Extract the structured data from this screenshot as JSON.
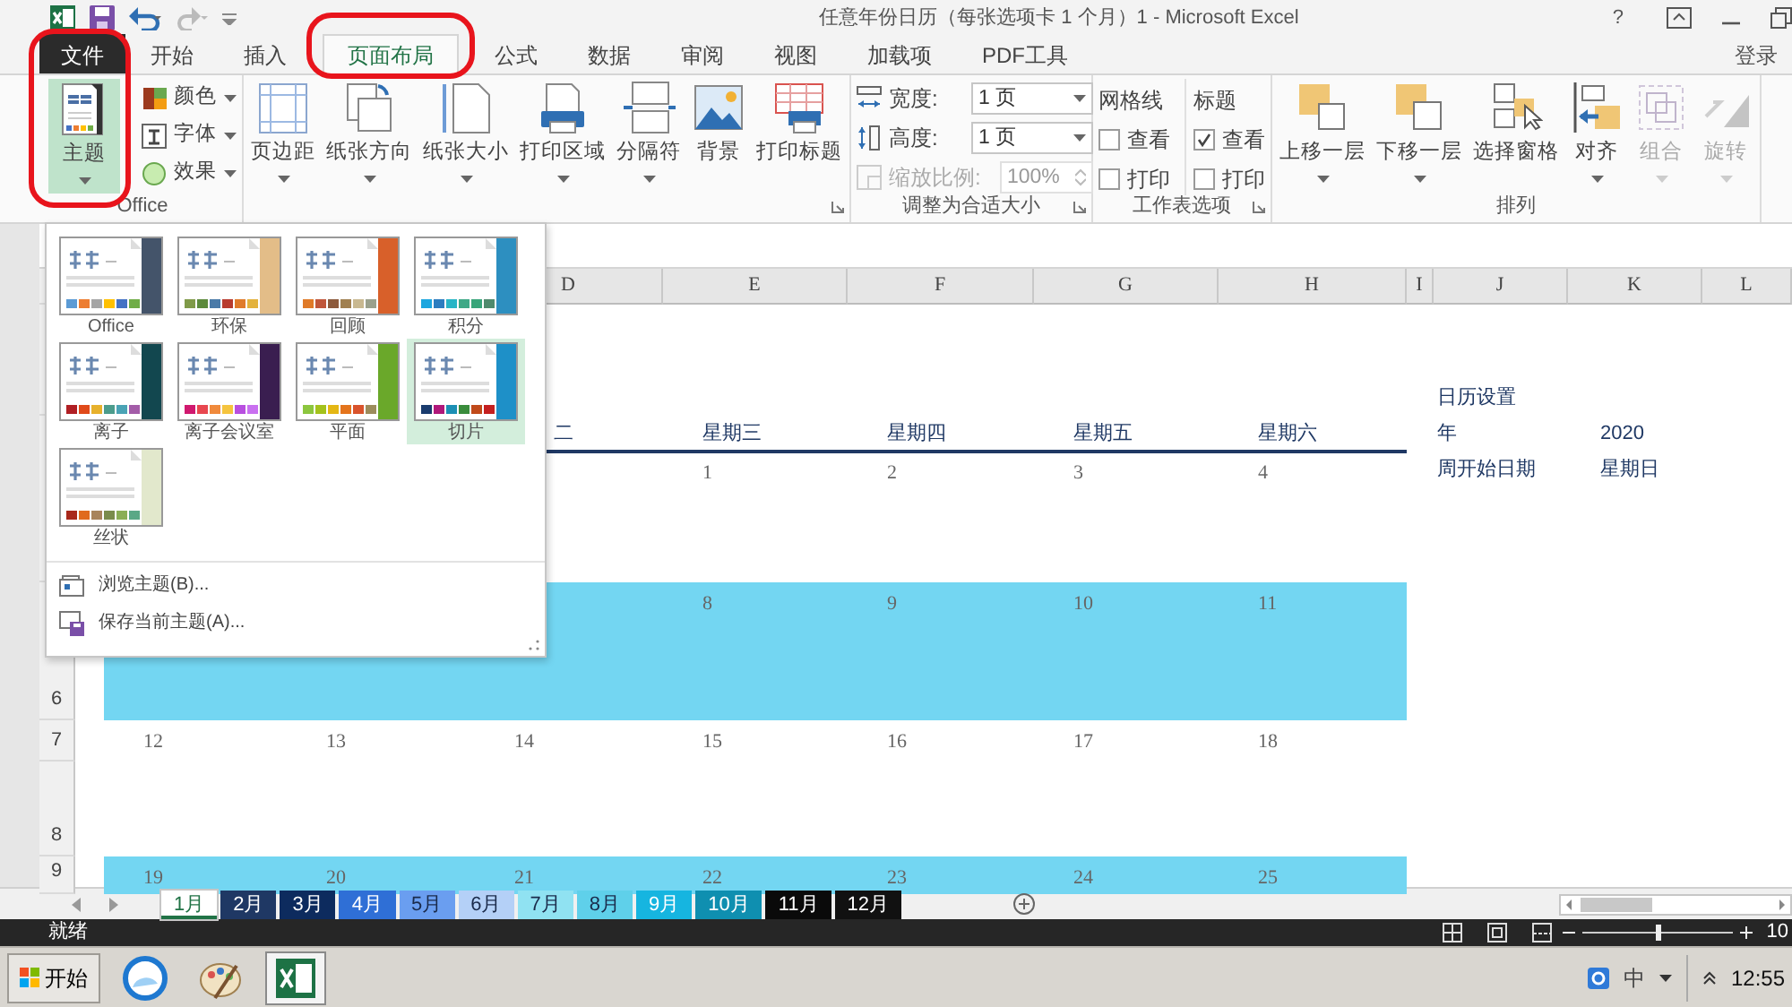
{
  "window": {
    "title": "任意年份日历（每张选项卡 1 个月）1 - Microsoft Excel",
    "help": "?"
  },
  "tabs": [
    {
      "label": "文件",
      "kind": "file",
      "selected": false,
      "highlighted": false
    },
    {
      "label": "开始",
      "kind": "tab",
      "selected": false,
      "highlighted": false
    },
    {
      "label": "插入",
      "kind": "tab",
      "selected": false,
      "highlighted": false
    },
    {
      "label": "页面布局",
      "kind": "tab",
      "selected": true,
      "highlighted": true
    },
    {
      "label": "公式",
      "kind": "tab",
      "selected": false,
      "highlighted": false
    },
    {
      "label": "数据",
      "kind": "tab",
      "selected": false,
      "highlighted": false
    },
    {
      "label": "审阅",
      "kind": "tab",
      "selected": false,
      "highlighted": false
    },
    {
      "label": "视图",
      "kind": "tab",
      "selected": false,
      "highlighted": false
    },
    {
      "label": "加载项",
      "kind": "tab",
      "selected": false,
      "highlighted": false
    },
    {
      "label": "PDF工具",
      "kind": "tab",
      "selected": false,
      "highlighted": false
    }
  ],
  "account": "登录",
  "ribbon": {
    "groups": [
      {
        "kind": "buttons",
        "label": "Office",
        "launcher": false,
        "buttons": [
          {
            "label": "主题",
            "kind": "large",
            "dropdown": true,
            "selected": true,
            "highlighted": true,
            "disabled": false
          },
          {
            "label": "颜色",
            "kind": "small",
            "dropdown": true,
            "selected": false,
            "highlighted": false,
            "disabled": false
          },
          {
            "label": "字体",
            "kind": "small",
            "dropdown": true,
            "selected": false,
            "highlighted": false,
            "disabled": false
          },
          {
            "label": "效果",
            "kind": "small",
            "dropdown": true,
            "selected": false,
            "highlighted": false,
            "disabled": false
          }
        ]
      },
      {
        "kind": "buttons",
        "launcher": true,
        "buttons": [
          {
            "label": "页边距",
            "kind": "large",
            "dropdown": true,
            "selected": false,
            "highlighted": false,
            "disabled": false
          },
          {
            "label": "纸张方向",
            "kind": "large",
            "dropdown": true,
            "selected": false,
            "highlighted": false,
            "disabled": false
          },
          {
            "label": "纸张大小",
            "kind": "large",
            "dropdown": true,
            "selected": false,
            "highlighted": false,
            "disabled": false
          },
          {
            "label": "打印区域",
            "kind": "large",
            "dropdown": true,
            "selected": false,
            "highlighted": false,
            "disabled": false
          },
          {
            "label": "分隔符",
            "kind": "large",
            "dropdown": true,
            "selected": false,
            "highlighted": false,
            "disabled": false
          },
          {
            "label": "背景",
            "kind": "large",
            "dropdown": false,
            "selected": false,
            "highlighted": false,
            "disabled": false
          },
          {
            "label": "打印标题",
            "kind": "large",
            "dropdown": false,
            "selected": false,
            "highlighted": false,
            "disabled": false
          }
        ]
      },
      {
        "kind": "scale",
        "label": "调整为合适大小",
        "launcher": true,
        "fields": [
          {
            "label": "宽度:",
            "value": "1 页",
            "disabled": false
          },
          {
            "label": "高度:",
            "value": "1 页",
            "disabled": false
          },
          {
            "label": "缩放比例:",
            "value": "100%",
            "disabled": true
          }
        ]
      },
      {
        "kind": "options",
        "label": "工作表选项",
        "launcher": true,
        "columns": [
          {
            "title": "网格线",
            "checks": [
              {
                "label": "查看",
                "checked": false
              },
              {
                "label": "打印",
                "checked": false
              }
            ]
          },
          {
            "title": "标题",
            "checks": [
              {
                "label": "查看",
                "checked": true
              },
              {
                "label": "打印",
                "checked": false
              }
            ]
          }
        ]
      },
      {
        "kind": "buttons",
        "label": "排列",
        "launcher": false,
        "buttons": [
          {
            "label": "上移一层",
            "kind": "large",
            "dropdown": true,
            "selected": false,
            "highlighted": false,
            "disabled": false
          },
          {
            "label": "下移一层",
            "kind": "large",
            "dropdown": true,
            "selected": false,
            "highlighted": false,
            "disabled": false
          },
          {
            "label": "选择窗格",
            "kind": "large",
            "dropdown": false,
            "selected": false,
            "highlighted": false,
            "disabled": false
          },
          {
            "label": "对齐",
            "kind": "large",
            "dropdown": true,
            "selected": false,
            "highlighted": false,
            "disabled": false
          },
          {
            "label": "组合",
            "kind": "large",
            "dropdown": true,
            "selected": false,
            "highlighted": false,
            "disabled": true
          },
          {
            "label": "旋转",
            "kind": "large",
            "dropdown": true,
            "selected": false,
            "highlighted": false,
            "disabled": true
          }
        ]
      }
    ]
  },
  "theme_menu": {
    "themes": [
      {
        "label": "Office",
        "selected": false,
        "color": "#44546a",
        "swatches": [
          {
            "color": "#5b9bd5"
          },
          {
            "color": "#ed7d31"
          },
          {
            "color": "#a5a5a5"
          },
          {
            "color": "#ffc000"
          },
          {
            "color": "#4472c4"
          },
          {
            "color": "#70ad47"
          }
        ]
      },
      {
        "label": "环保",
        "selected": false,
        "color": "#e3bd88",
        "swatches": [
          {
            "color": "#7f9a48"
          },
          {
            "color": "#5c8a3c"
          },
          {
            "color": "#4a7aa8"
          },
          {
            "color": "#b83b2e"
          },
          {
            "color": "#e07b2a"
          },
          {
            "color": "#e3b23c"
          }
        ]
      },
      {
        "label": "回顾",
        "selected": false,
        "color": "#d8602a",
        "swatches": [
          {
            "color": "#e07a28"
          },
          {
            "color": "#c0563a"
          },
          {
            "color": "#8c5a3c"
          },
          {
            "color": "#a08050"
          },
          {
            "color": "#c8b890"
          },
          {
            "color": "#9aa08c"
          }
        ]
      },
      {
        "label": "积分",
        "selected": false,
        "color": "#2d8fc0",
        "swatches": [
          {
            "color": "#1ca6df"
          },
          {
            "color": "#2b7dc0"
          },
          {
            "color": "#27b5c6"
          },
          {
            "color": "#3fa987"
          },
          {
            "color": "#38a57a"
          },
          {
            "color": "#4f8a6d"
          }
        ]
      },
      {
        "label": "离子",
        "selected": false,
        "color": "#12474f",
        "swatches": [
          {
            "color": "#b01f24"
          },
          {
            "color": "#e04a1a"
          },
          {
            "color": "#e7b12c"
          },
          {
            "color": "#4c9c8c"
          },
          {
            "color": "#4aa3b5"
          },
          {
            "color": "#a35ca8"
          }
        ]
      },
      {
        "label": "离子会议室",
        "selected": false,
        "color": "#3a1e50",
        "swatches": [
          {
            "color": "#d0196f"
          },
          {
            "color": "#e8474f"
          },
          {
            "color": "#f08a3c"
          },
          {
            "color": "#f5c43e"
          },
          {
            "color": "#b84fe0"
          },
          {
            "color": "#c970f0"
          }
        ]
      },
      {
        "label": "平面",
        "selected": false,
        "color": "#6aa82a",
        "swatches": [
          {
            "color": "#8cc63f"
          },
          {
            "color": "#a4c21c"
          },
          {
            "color": "#e4b714"
          },
          {
            "color": "#e4741c"
          },
          {
            "color": "#d9532c"
          },
          {
            "color": "#9c8c5c"
          }
        ]
      },
      {
        "label": "切片",
        "selected": true,
        "color": "#1e90c8",
        "swatches": [
          {
            "color": "#1a3c6e"
          },
          {
            "color": "#b0187a"
          },
          {
            "color": "#1c8fb4"
          },
          {
            "color": "#3a8c3c"
          },
          {
            "color": "#c04a1a"
          },
          {
            "color": "#c42020"
          }
        ]
      },
      {
        "label": "丝状",
        "selected": false,
        "color": "#e2e8cc",
        "swatches": [
          {
            "color": "#a8281c"
          },
          {
            "color": "#e06a1e"
          },
          {
            "color": "#a8845c"
          },
          {
            "color": "#7a8c4c"
          },
          {
            "color": "#8aae56"
          },
          {
            "color": "#5aa886"
          }
        ]
      }
    ],
    "menu": [
      {
        "label": "浏览主题(B)..."
      },
      {
        "label": "保存当前主题(A)..."
      }
    ]
  },
  "sheet": {
    "columns": [
      "D",
      "E",
      "F",
      "G",
      "H",
      "I",
      "J",
      "K",
      "L"
    ],
    "settings": {
      "title": "日历设置",
      "items": [
        {
          "label": "年",
          "value": "2020"
        },
        {
          "label": "周开始日期",
          "value": "星期日"
        }
      ]
    },
    "weekdays": [
      "二",
      "星期三",
      "星期四",
      "星期五",
      "星期六"
    ],
    "rows": [
      {
        "kind": "week",
        "band": false,
        "cells": [
          {
            "kind": "empty"
          },
          {
            "kind": "empty"
          },
          {
            "kind": "empty"
          },
          {
            "kind": "day",
            "label": "1"
          },
          {
            "kind": "day",
            "label": "2"
          },
          {
            "kind": "day",
            "label": "3"
          },
          {
            "kind": "day",
            "label": "4"
          }
        ]
      },
      {
        "kind": "week",
        "band": true,
        "number": "6",
        "cells": [
          {
            "kind": "empty"
          },
          {
            "kind": "empty"
          },
          {
            "kind": "empty"
          },
          {
            "kind": "day",
            "label": "8"
          },
          {
            "kind": "day",
            "label": "9"
          },
          {
            "kind": "day",
            "label": "10"
          },
          {
            "kind": "day",
            "label": "11"
          }
        ]
      },
      {
        "kind": "week",
        "band": false,
        "number": "7",
        "cells": [
          {
            "kind": "day",
            "label": "12"
          },
          {
            "kind": "day",
            "label": "13"
          },
          {
            "kind": "day",
            "label": "14"
          },
          {
            "kind": "day",
            "label": "15"
          },
          {
            "kind": "day",
            "label": "16"
          },
          {
            "kind": "day",
            "label": "17"
          },
          {
            "kind": "day",
            "label": "18"
          }
        ]
      },
      {
        "kind": "blank",
        "band": false,
        "number": "8"
      },
      {
        "kind": "week",
        "band": true,
        "number": "9",
        "cells": [
          {
            "kind": "day",
            "label": "19"
          },
          {
            "kind": "day",
            "label": "20"
          },
          {
            "kind": "day",
            "label": "21"
          },
          {
            "kind": "day",
            "label": "22"
          },
          {
            "kind": "day",
            "label": "23"
          },
          {
            "kind": "day",
            "label": "24"
          },
          {
            "kind": "day",
            "label": "25"
          }
        ]
      }
    ]
  },
  "sheet_tabs": [
    {
      "label": "1月",
      "selected": true,
      "color": "#ffffff"
    },
    {
      "label": "2月",
      "selected": false,
      "color": "#1f3864"
    },
    {
      "label": "3月",
      "selected": false,
      "color": "#0d2b5e"
    },
    {
      "label": "4月",
      "selected": false,
      "color": "#2f6fd6"
    },
    {
      "label": "5月",
      "selected": false,
      "color": "#6a9ef0"
    },
    {
      "label": "6月",
      "selected": false,
      "color": "#b4d0f7"
    },
    {
      "label": "7月",
      "selected": false,
      "color": "#90e2f2"
    },
    {
      "label": "8月",
      "selected": false,
      "color": "#5fd0ea"
    },
    {
      "label": "9月",
      "selected": false,
      "color": "#16b5e0"
    },
    {
      "label": "10月",
      "selected": false,
      "color": "#0f8fb0"
    },
    {
      "label": "11月",
      "selected": false,
      "color": "#0a0a0a"
    },
    {
      "label": "12月",
      "selected": false,
      "color": "#111111"
    }
  ],
  "status_bar": {
    "status": "就绪",
    "zoom": {
      "level": 0.5,
      "reading": "10"
    }
  },
  "taskbar": {
    "start": "开始",
    "apps": [
      {
        "active": false
      },
      {
        "active": false
      },
      {
        "active": true
      }
    ],
    "ime": "中",
    "time": "12:55"
  }
}
